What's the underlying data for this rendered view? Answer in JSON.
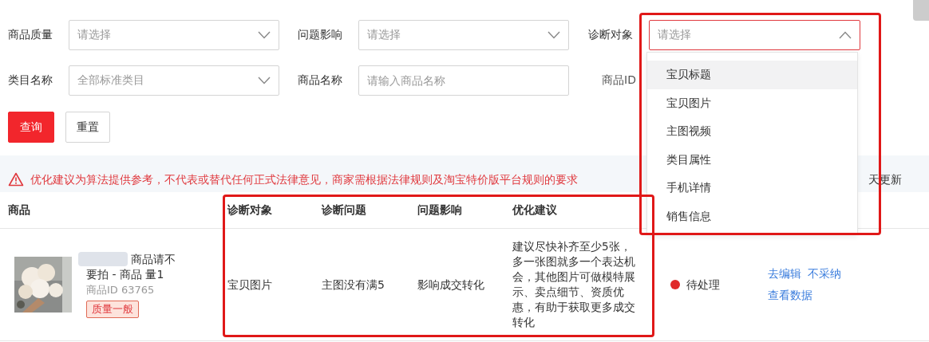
{
  "filters": [
    {
      "label": "商品质量",
      "kind": "select",
      "placeholder": "请选择",
      "expanded": false
    },
    {
      "label": "问题影响",
      "kind": "select",
      "placeholder": "请选择",
      "expanded": false
    },
    {
      "label": "诊断对象",
      "kind": "select",
      "placeholder": "请选择",
      "expanded": true
    },
    {
      "label": "类目名称",
      "kind": "select",
      "placeholder": "全部标准类目",
      "expanded": false
    },
    {
      "label": "商品名称",
      "kind": "input",
      "placeholder": "请输入商品名称"
    },
    {
      "label": "商品ID",
      "kind": "hidden"
    }
  ],
  "buttons": [
    {
      "label": "查询",
      "kind": "primary"
    },
    {
      "label": "重置",
      "kind": "default"
    }
  ],
  "notice": {
    "text": "优化建议为算法提供参考，不代表或替代任何正式法律意见，商家需根据法律规则及淘宝特价版平台规则的要求",
    "update_note": "天更新"
  },
  "dropdown": {
    "options": [
      {
        "label": "宝贝标题",
        "hovered": true
      },
      {
        "label": "宝贝图片",
        "hovered": false
      },
      {
        "label": "主图视频",
        "hovered": false
      },
      {
        "label": "类目属性",
        "hovered": false
      },
      {
        "label": "手机详情",
        "hovered": false
      },
      {
        "label": "销售信息",
        "hovered": false
      }
    ]
  },
  "table": {
    "columns": [
      "商品",
      "诊断对象",
      "诊断问题",
      "问题影响",
      "优化建议"
    ],
    "rows": [
      {
        "product": {
          "kind": "picture",
          "name_lines": [
            "商品请不",
            "要拍 - 商品 量1"
          ],
          "id": "商品ID 63765",
          "tag": "质量一般"
        },
        "target": "宝贝图片",
        "problem": "主图没有满5",
        "impact": "影响成交转化",
        "advice": "建议尽快补齐至少5张，多一张图就多一个表达机会，其他图片可做模特展示、卖点细节、资质优惠，有助于获取更多成交转化",
        "status": "待处理",
        "actions": [
          [
            "去编辑",
            "不采纳"
          ],
          [
            "查看数据"
          ]
        ]
      }
    ]
  }
}
